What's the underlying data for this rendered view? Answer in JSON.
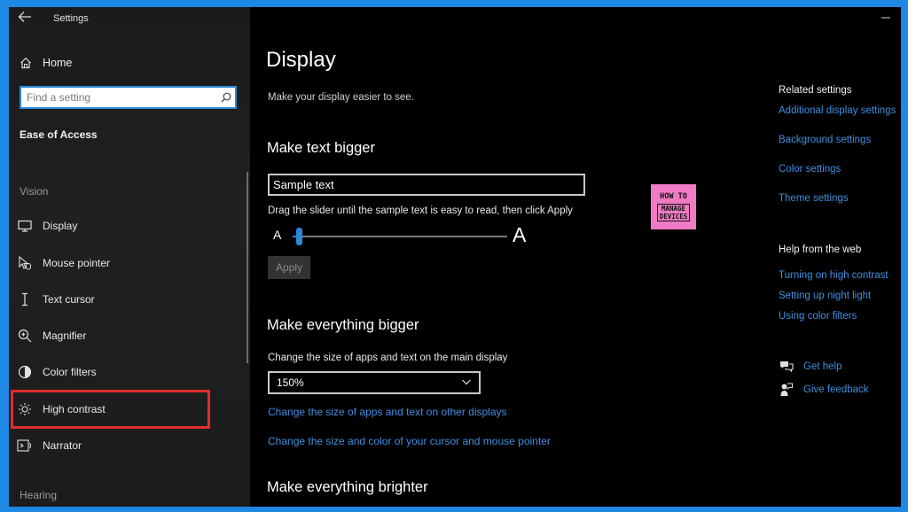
{
  "window": {
    "title": "Settings"
  },
  "sidebar": {
    "home_label": "Home",
    "search_placeholder": "Find a setting",
    "section": "Ease of Access",
    "groups": {
      "vision": "Vision",
      "hearing": "Hearing"
    },
    "items": [
      {
        "label": "Display",
        "icon": "monitor-icon"
      },
      {
        "label": "Mouse pointer",
        "icon": "mouse-pointer-icon"
      },
      {
        "label": "Text cursor",
        "icon": "text-cursor-icon"
      },
      {
        "label": "Magnifier",
        "icon": "magnifier-icon"
      },
      {
        "label": "Color filters",
        "icon": "color-filters-icon"
      },
      {
        "label": "High contrast",
        "icon": "high-contrast-icon",
        "highlighted": true
      },
      {
        "label": "Narrator",
        "icon": "narrator-icon"
      }
    ]
  },
  "main": {
    "title": "Display",
    "subtitle": "Make your display easier to see.",
    "text_bigger": {
      "heading": "Make text bigger",
      "sample_text": "Sample text",
      "instruction": "Drag the slider until the sample text is easy to read, then click Apply",
      "slider_min_label": "A",
      "slider_max_label": "A",
      "slider_value": 0.02,
      "apply_label": "Apply"
    },
    "everything_bigger": {
      "heading": "Make everything bigger",
      "instruction": "Change the size of apps and text on the main display",
      "scale_value": "150%",
      "link_other_displays": "Change the size of apps and text on other displays",
      "link_cursor": "Change the size and color of your cursor and mouse pointer"
    },
    "everything_brighter": {
      "heading": "Make everything brighter"
    },
    "logo": {
      "line1": "HOW TO",
      "line2": "MANAGE",
      "line3": "DEVICES"
    }
  },
  "related": {
    "heading": "Related settings",
    "links": [
      "Additional display settings",
      "Background settings",
      "Color settings",
      "Theme settings"
    ]
  },
  "help": {
    "heading": "Help from the web",
    "links": [
      "Turning on high contrast",
      "Setting up night light",
      "Using color filters"
    ]
  },
  "support": {
    "get_help": "Get help",
    "give_feedback": "Give feedback"
  },
  "colors": {
    "accent": "#2b88d8",
    "link": "#3f8fe0",
    "highlight": "#e02d2d",
    "frame": "#1e88e5"
  }
}
